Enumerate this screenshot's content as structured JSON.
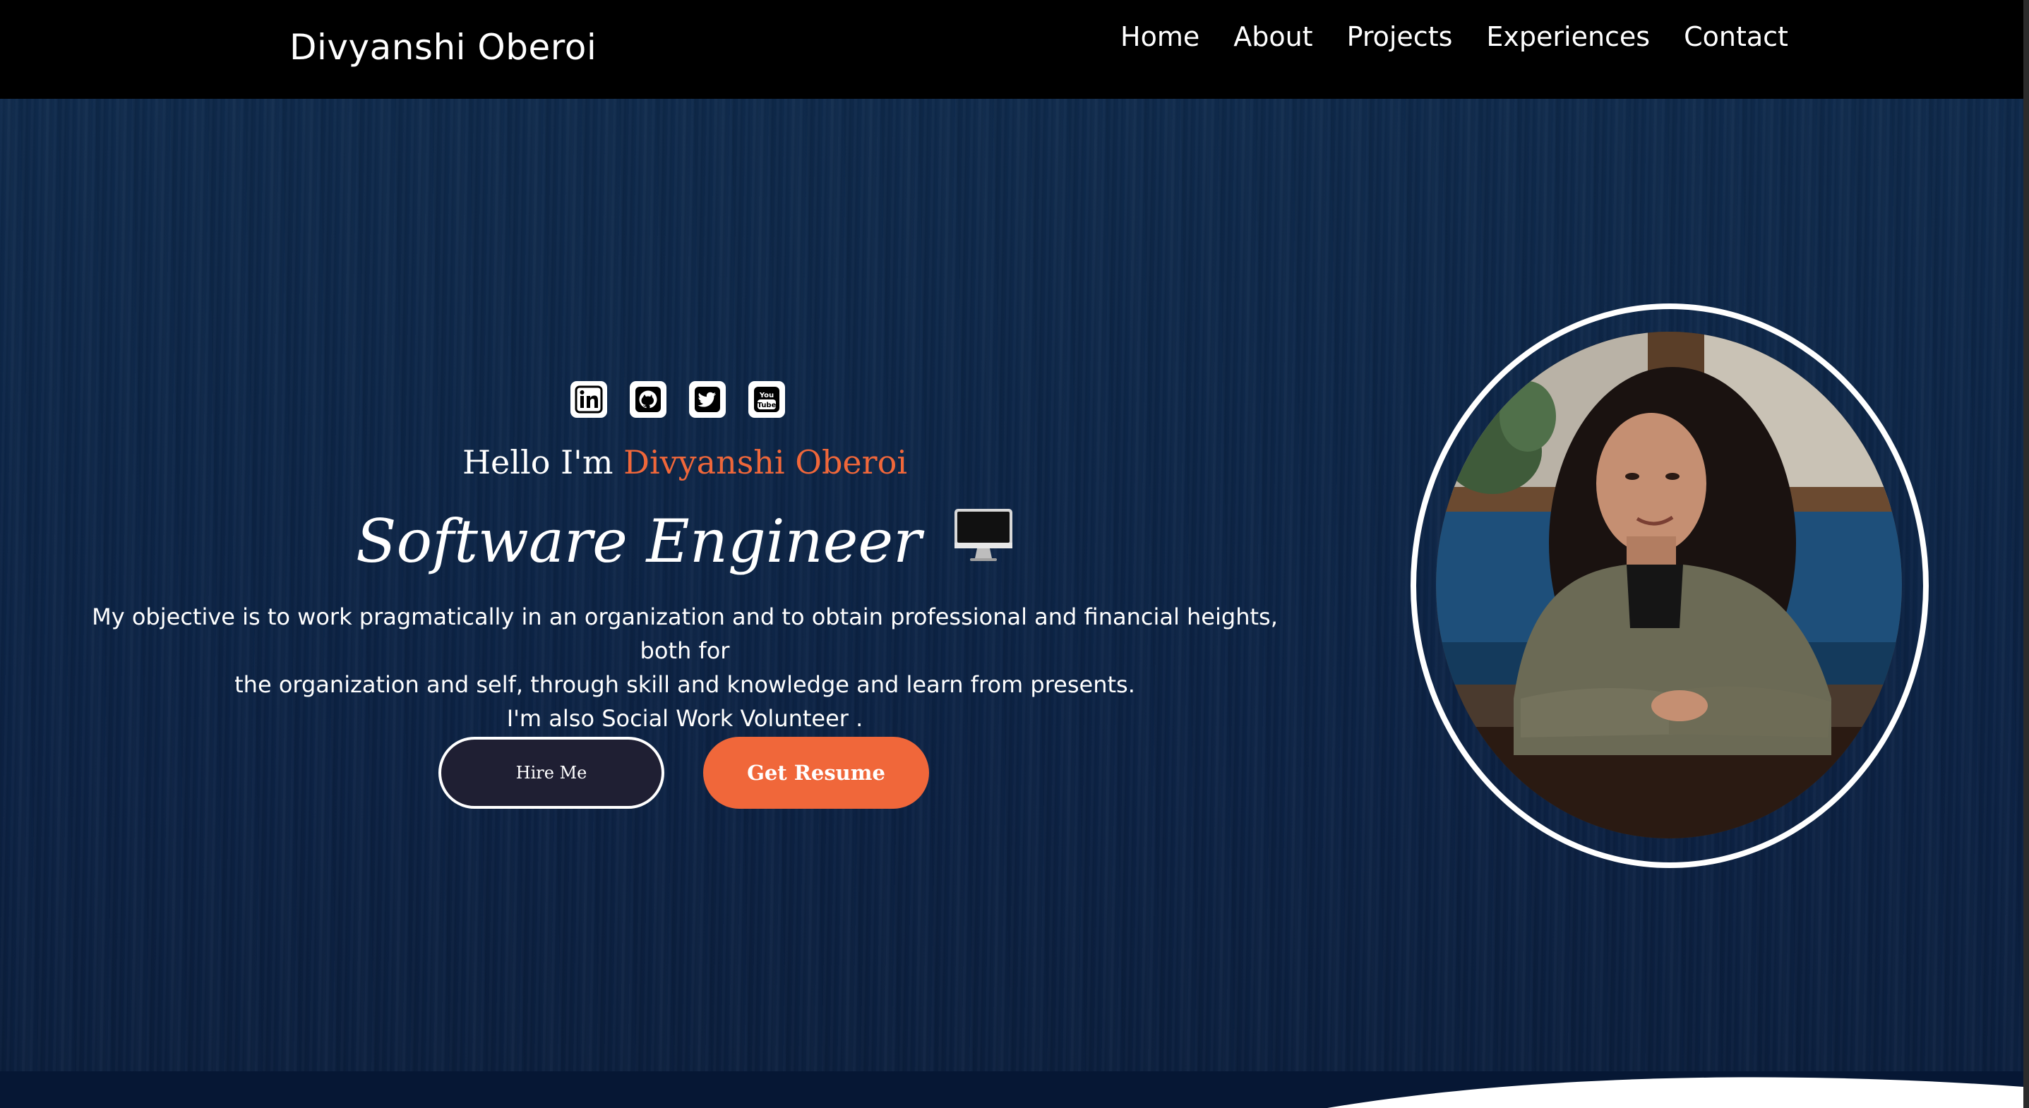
{
  "navbar": {
    "brand": "Divyanshi Oberoi",
    "links": [
      "Home",
      "About",
      "Projects",
      "Experiences",
      "Contact"
    ]
  },
  "hero": {
    "socials": [
      "linkedin-icon",
      "github-icon",
      "twitter-icon",
      "youtube-icon"
    ],
    "hello_prefix": "Hello I'm ",
    "hello_name": "Divyanshi Oberoi",
    "role": "Software Engineer",
    "role_icon": "desktop-monitor-icon",
    "objective_line1": "My objective is to work pragmatically in an organization and to obtain professional and financial heights, both for",
    "objective_line2": "the organization and self, through skill and knowledge and learn from presents.",
    "objective_line3": "I'm also Social Work Volunteer .",
    "hire_label": "Hire Me",
    "resume_label": "Get Resume"
  },
  "colors": {
    "accent": "#f0673a",
    "navbar_bg": "#000000",
    "hero_bg": "#0d2648",
    "hire_bg": "#1f1f33"
  }
}
